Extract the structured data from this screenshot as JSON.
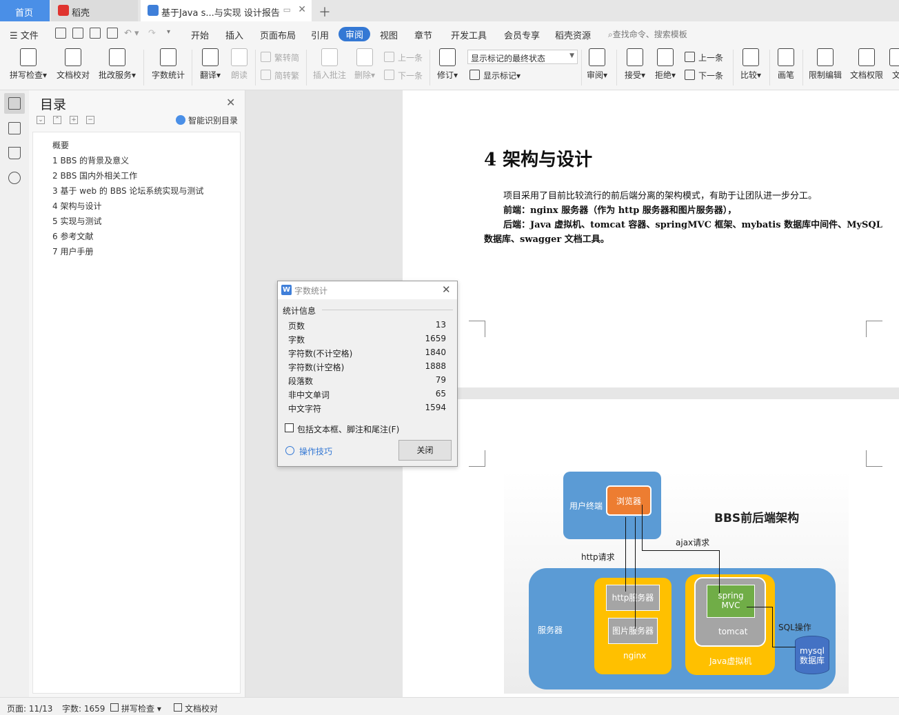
{
  "tabs": {
    "home": "首页",
    "daoke": "稻壳",
    "doc": "基于Java s...与实现 设计报告"
  },
  "menu": {
    "file": "文件",
    "items": [
      "开始",
      "插入",
      "页面布局",
      "引用",
      "审阅",
      "视图",
      "章节",
      "开发工具",
      "会员专享",
      "稻壳资源"
    ],
    "active": "审阅",
    "search": "查找命令、搜索模板"
  },
  "ribbon": {
    "spellcheck": "拼写检查",
    "doc_proof": "文档校对",
    "review_service": "批改服务",
    "word_count": "字数统计",
    "translate": "翻译",
    "read_aloud": "朗读",
    "to_traditional": "繁转简",
    "to_simplified": "简转繁",
    "insert_comment": "插入批注",
    "delete": "删除",
    "prev": "上一条",
    "next": "下一条",
    "track_changes": "修订",
    "markup_state": "显示标记的最终状态",
    "show_markup": "显示标记",
    "review": "审阅",
    "accept": "接受",
    "reject": "拒绝",
    "prev2": "上一条",
    "next2": "下一条",
    "compare": "比较",
    "pen": "画笔",
    "restrict_edit": "限制编辑",
    "doc_permission": "文档权限",
    "cut_label": "文"
  },
  "toc": {
    "title": "目录",
    "smart": "智能识别目录",
    "items": [
      "概要",
      "1 BBS 的背景及意义",
      "2 BBS 国内外相关工作",
      "3  基于 web 的 BBS 论坛系统实现与测试",
      "4 架构与设计",
      "5 实现与测试",
      "6 参考文献",
      "7 用户手册"
    ]
  },
  "document": {
    "heading": "4 架构与设计",
    "p1": "项目采用了目前比较流行的前后端分离的架构模式，有助于让团队进一步分工。",
    "p2": "前端：nginx 服务器（作为 http 服务器和图片服务器），",
    "p3a": "后端：Java 虚拟机、tomcat 容器、springMVC 框架、mybatis 数据库中间件、MySQL",
    "p3b": "数据库、swagger 文档工具。"
  },
  "diagram": {
    "title": "BBS前后端架构",
    "user_terminal": "用户终端",
    "browser": "浏览器",
    "ajax": "ajax请求",
    "http_req": "http请求",
    "server": "服务器",
    "http_server": "http服务器",
    "image_server": "图片服务器",
    "nginx": "nginx",
    "spring": "spring",
    "mvc": "MVC",
    "tomcat": "tomcat",
    "jvm": "Java虚拟机",
    "sql": "SQL操作",
    "mysql": "mysql",
    "db": "数据库"
  },
  "dialog": {
    "title": "字数统计",
    "section": "统计信息",
    "stats": [
      {
        "label": "页数",
        "value": "13"
      },
      {
        "label": "字数",
        "value": "1659"
      },
      {
        "label": "字符数(不计空格)",
        "value": "1840"
      },
      {
        "label": "字符数(计空格)",
        "value": "1888"
      },
      {
        "label": "段落数",
        "value": "79"
      },
      {
        "label": "非中文单词",
        "value": "65"
      },
      {
        "label": "中文字符",
        "value": "1594"
      }
    ],
    "checkbox": "包括文本框、脚注和尾注(F)",
    "tips": "操作技巧",
    "close": "关闭"
  },
  "status": {
    "page": "页面: 11/13",
    "words": "字数: 1659",
    "spell": "拼写检查",
    "proof": "文档校对"
  },
  "colors": {
    "accent": "#3478d4",
    "home_tab": "#4a8fe7",
    "diagram_blue": "#5b9bd5",
    "diagram_orange": "#ed7d31",
    "diagram_yellow": "#ffc000",
    "diagram_green": "#70ad47"
  }
}
